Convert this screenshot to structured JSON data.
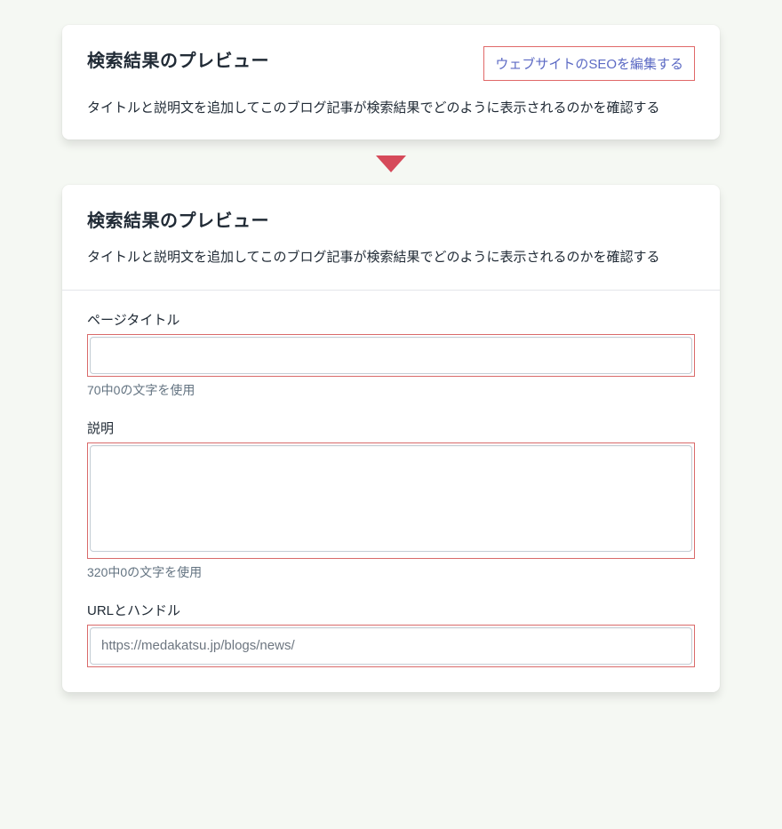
{
  "preview_collapsed": {
    "title": "検索結果のプレビュー",
    "edit_link": "ウェブサイトのSEOを編集する",
    "description": "タイトルと説明文を追加してこのブログ記事が検索結果でどのように表示されるのかを確認する"
  },
  "preview_expanded": {
    "title": "検索結果のプレビュー",
    "description": "タイトルと説明文を追加してこのブログ記事が検索結果でどのように表示されるのかを確認する",
    "fields": {
      "page_title": {
        "label": "ページタイトル",
        "value": "",
        "helper": "70中0の文字を使用"
      },
      "meta_description": {
        "label": "説明",
        "value": "",
        "helper": "320中0の文字を使用"
      },
      "url_handle": {
        "label": "URLとハンドル",
        "value": "https://medakatsu.jp/blogs/news/"
      }
    }
  }
}
